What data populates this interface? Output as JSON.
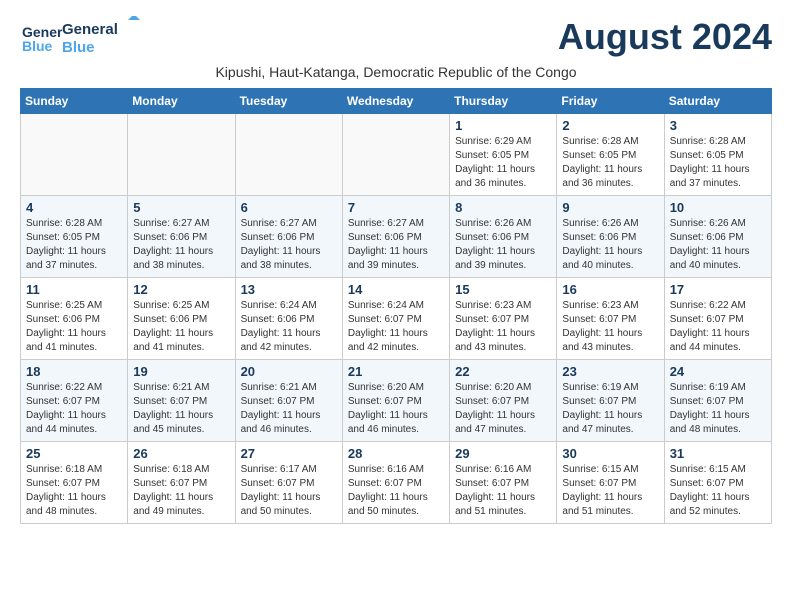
{
  "logo": {
    "general": "General",
    "blue": "Blue"
  },
  "title": "August 2024",
  "subtitle": "Kipushi, Haut-Katanga, Democratic Republic of the Congo",
  "headers": [
    "Sunday",
    "Monday",
    "Tuesday",
    "Wednesday",
    "Thursday",
    "Friday",
    "Saturday"
  ],
  "weeks": [
    [
      {
        "day": "",
        "info": ""
      },
      {
        "day": "",
        "info": ""
      },
      {
        "day": "",
        "info": ""
      },
      {
        "day": "",
        "info": ""
      },
      {
        "day": "1",
        "info": "Sunrise: 6:29 AM\nSunset: 6:05 PM\nDaylight: 11 hours\nand 36 minutes."
      },
      {
        "day": "2",
        "info": "Sunrise: 6:28 AM\nSunset: 6:05 PM\nDaylight: 11 hours\nand 36 minutes."
      },
      {
        "day": "3",
        "info": "Sunrise: 6:28 AM\nSunset: 6:05 PM\nDaylight: 11 hours\nand 37 minutes."
      }
    ],
    [
      {
        "day": "4",
        "info": "Sunrise: 6:28 AM\nSunset: 6:05 PM\nDaylight: 11 hours\nand 37 minutes."
      },
      {
        "day": "5",
        "info": "Sunrise: 6:27 AM\nSunset: 6:06 PM\nDaylight: 11 hours\nand 38 minutes."
      },
      {
        "day": "6",
        "info": "Sunrise: 6:27 AM\nSunset: 6:06 PM\nDaylight: 11 hours\nand 38 minutes."
      },
      {
        "day": "7",
        "info": "Sunrise: 6:27 AM\nSunset: 6:06 PM\nDaylight: 11 hours\nand 39 minutes."
      },
      {
        "day": "8",
        "info": "Sunrise: 6:26 AM\nSunset: 6:06 PM\nDaylight: 11 hours\nand 39 minutes."
      },
      {
        "day": "9",
        "info": "Sunrise: 6:26 AM\nSunset: 6:06 PM\nDaylight: 11 hours\nand 40 minutes."
      },
      {
        "day": "10",
        "info": "Sunrise: 6:26 AM\nSunset: 6:06 PM\nDaylight: 11 hours\nand 40 minutes."
      }
    ],
    [
      {
        "day": "11",
        "info": "Sunrise: 6:25 AM\nSunset: 6:06 PM\nDaylight: 11 hours\nand 41 minutes."
      },
      {
        "day": "12",
        "info": "Sunrise: 6:25 AM\nSunset: 6:06 PM\nDaylight: 11 hours\nand 41 minutes."
      },
      {
        "day": "13",
        "info": "Sunrise: 6:24 AM\nSunset: 6:06 PM\nDaylight: 11 hours\nand 42 minutes."
      },
      {
        "day": "14",
        "info": "Sunrise: 6:24 AM\nSunset: 6:07 PM\nDaylight: 11 hours\nand 42 minutes."
      },
      {
        "day": "15",
        "info": "Sunrise: 6:23 AM\nSunset: 6:07 PM\nDaylight: 11 hours\nand 43 minutes."
      },
      {
        "day": "16",
        "info": "Sunrise: 6:23 AM\nSunset: 6:07 PM\nDaylight: 11 hours\nand 43 minutes."
      },
      {
        "day": "17",
        "info": "Sunrise: 6:22 AM\nSunset: 6:07 PM\nDaylight: 11 hours\nand 44 minutes."
      }
    ],
    [
      {
        "day": "18",
        "info": "Sunrise: 6:22 AM\nSunset: 6:07 PM\nDaylight: 11 hours\nand 44 minutes."
      },
      {
        "day": "19",
        "info": "Sunrise: 6:21 AM\nSunset: 6:07 PM\nDaylight: 11 hours\nand 45 minutes."
      },
      {
        "day": "20",
        "info": "Sunrise: 6:21 AM\nSunset: 6:07 PM\nDaylight: 11 hours\nand 46 minutes."
      },
      {
        "day": "21",
        "info": "Sunrise: 6:20 AM\nSunset: 6:07 PM\nDaylight: 11 hours\nand 46 minutes."
      },
      {
        "day": "22",
        "info": "Sunrise: 6:20 AM\nSunset: 6:07 PM\nDaylight: 11 hours\nand 47 minutes."
      },
      {
        "day": "23",
        "info": "Sunrise: 6:19 AM\nSunset: 6:07 PM\nDaylight: 11 hours\nand 47 minutes."
      },
      {
        "day": "24",
        "info": "Sunrise: 6:19 AM\nSunset: 6:07 PM\nDaylight: 11 hours\nand 48 minutes."
      }
    ],
    [
      {
        "day": "25",
        "info": "Sunrise: 6:18 AM\nSunset: 6:07 PM\nDaylight: 11 hours\nand 48 minutes."
      },
      {
        "day": "26",
        "info": "Sunrise: 6:18 AM\nSunset: 6:07 PM\nDaylight: 11 hours\nand 49 minutes."
      },
      {
        "day": "27",
        "info": "Sunrise: 6:17 AM\nSunset: 6:07 PM\nDaylight: 11 hours\nand 50 minutes."
      },
      {
        "day": "28",
        "info": "Sunrise: 6:16 AM\nSunset: 6:07 PM\nDaylight: 11 hours\nand 50 minutes."
      },
      {
        "day": "29",
        "info": "Sunrise: 6:16 AM\nSunset: 6:07 PM\nDaylight: 11 hours\nand 51 minutes."
      },
      {
        "day": "30",
        "info": "Sunrise: 6:15 AM\nSunset: 6:07 PM\nDaylight: 11 hours\nand 51 minutes."
      },
      {
        "day": "31",
        "info": "Sunrise: 6:15 AM\nSunset: 6:07 PM\nDaylight: 11 hours\nand 52 minutes."
      }
    ]
  ]
}
